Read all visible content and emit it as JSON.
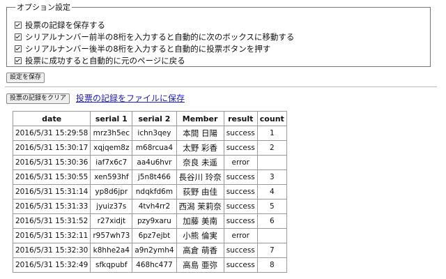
{
  "options": {
    "legend": "オプション設定",
    "items": [
      {
        "label": "投票の記録を保存する",
        "checked": true
      },
      {
        "label": "シリアルナンバー前半の8桁を入力すると自動的に次のボックスに移動する",
        "checked": true
      },
      {
        "label": "シリアルナンバー後半の8桁を入力すると自動的に投票ボタンを押す",
        "checked": true
      },
      {
        "label": "投票に成功すると自動的に元のページに戻る",
        "checked": true
      }
    ],
    "save_label": "設定を保存"
  },
  "records": {
    "clear_label": "投票の記録をクリア",
    "file_link": "投票の記録をファイルに保存",
    "columns": [
      "date",
      "serial 1",
      "serial 2",
      "Member",
      "result",
      "count"
    ],
    "rows": [
      [
        "2016/5/31 15:29:58",
        "mrz3h5ec",
        "ichn3qey",
        "本間 日陽",
        "success",
        "1"
      ],
      [
        "2016/5/31 15:30:17",
        "xqjqem8z",
        "m68rcua4",
        "太野 彩香",
        "success",
        "2"
      ],
      [
        "2016/5/31 15:30:36",
        "iaf7x6c7",
        "aa4u6hvr",
        "奈良 未遥",
        "error",
        ""
      ],
      [
        "2016/5/31 15:30:55",
        "xen593hf",
        "j5n8t466",
        "長谷川 玲奈",
        "success",
        "3"
      ],
      [
        "2016/5/31 15:31:14",
        "yp8d6jpr",
        "ndqkfd6m",
        "荻野 由佳",
        "success",
        "4"
      ],
      [
        "2016/5/31 15:31:33",
        "jyuiz37s",
        "4tvh4rr2",
        "西潟 茉莉奈",
        "success",
        "5"
      ],
      [
        "2016/5/31 15:31:52",
        "r27xidjt",
        "pzy9xaru",
        "加藤 美南",
        "success",
        "6"
      ],
      [
        "2016/5/31 15:32:11",
        "r957wh73",
        "6pz7ejbt",
        "小熊 倫実",
        "error",
        ""
      ],
      [
        "2016/5/31 15:32:30",
        "k8hhe2a4",
        "a9n2ymh4",
        "高倉 萌香",
        "success",
        "7"
      ],
      [
        "2016/5/31 15:32:49",
        "sfkqpubf",
        "468hc477",
        "高島 亜弥",
        "success",
        "8"
      ]
    ]
  }
}
